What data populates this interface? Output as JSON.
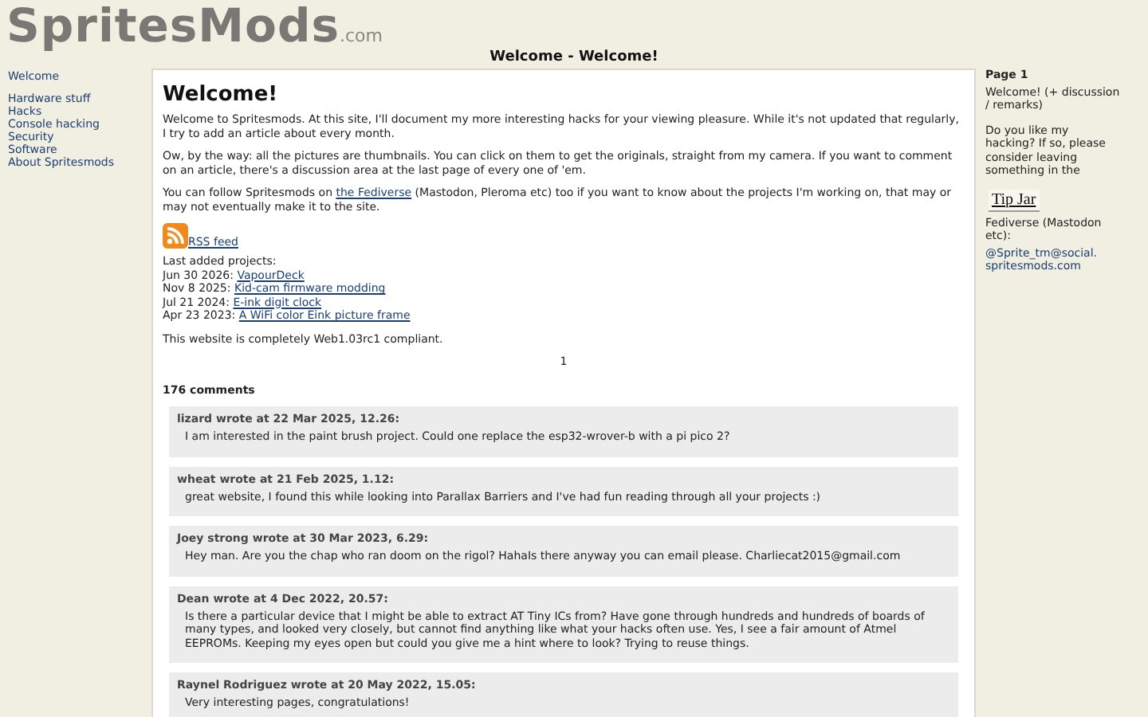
{
  "logo": {
    "name": "SpritesMods",
    "suffix": ".com"
  },
  "page_title": "Welcome - Welcome!",
  "nav": {
    "home": "Welcome",
    "items": [
      "Hardware stuff",
      "Hacks",
      "Console hacking",
      "Security",
      "Software",
      "About Spritesmods"
    ]
  },
  "article": {
    "heading": "Welcome!",
    "intro": "Welcome to Spritesmods. At this site, I'll document my more interesting hacks for your viewing pleasure. While it's not updated that regularly, I try to add an article about every month.",
    "note": "Ow, by the way: all the pictures are thumbnails. You can click on them to get the originals, straight from my camera. If you want to comment on an article, there's a discussion area at the last page of every one of 'em.",
    "follow": {
      "before": "You can follow Spritesmods on ",
      "link": "the Fediverse",
      "after": " (Mastodon, Pleroma etc) too if you want to know about the projects I'm working on, that may or may not eventually make it to the site."
    },
    "rss": "RSS feed",
    "projects_label": "Last added projects:",
    "projects": [
      {
        "date": "Jun 30 2026:",
        "title": "VapourDeck"
      },
      {
        "date": "Nov 8 2025:",
        "title": "Kid-cam firmware modding"
      },
      {
        "date": "Jul 21 2024:",
        "title": "E-ink digit clock"
      },
      {
        "date": "Apr 23 2023:",
        "title": "A WiFi color Eink picture frame"
      }
    ],
    "compliance": "This website is completely Web1.03rc1 compliant.",
    "pager": "1"
  },
  "comments": {
    "count": "176 comments",
    "items": [
      {
        "header": "lizard wrote at 22 Mar 2025, 12.26:",
        "text": "I am interested in the paint brush project. Could one replace the esp32-wrover-b with a pi pico 2?"
      },
      {
        "header": "wheat wrote at 21 Feb 2025, 1.12:",
        "text": "great website, I found this while looking into Parallax Barriers and I've had fun reading through all your projects :)"
      },
      {
        "header": "Joey strong wrote at 30 Mar 2023, 6.29:",
        "text": "Hey man. Are you the chap who ran doom on the rigol? HahaIs there anyway you can email please. Charliecat2015@gmail.com"
      },
      {
        "header": "Dean wrote at 4 Dec 2022, 20.57:",
        "text": "Is there a particular device that I might be able to extract AT Tiny ICs from? Have gone through hundreds and hundreds of boards of many types, and looked very closely, but cannot find anything like what your hacks often use. Yes, I see a fair amount of Atmel EEPROMs. Keeping my eyes open but could you give me a hint where to look? Trying to reuse things."
      },
      {
        "header": "Raynel Rodriguez wrote at 20 May 2022, 15.05:",
        "text": "Very interesting pages, congratulations!"
      }
    ]
  },
  "sidebar": {
    "page": "Page 1",
    "page_desc": "Welcome! (+ discussion / remarks)",
    "donate": "Do you like my hacking? If so, please consider leaving something in the",
    "tip_jar": "Tip Jar",
    "fediverse": "Fediverse (Mastodon etc):",
    "handle": "@Sprite_tm@social. spritesmods.com"
  }
}
